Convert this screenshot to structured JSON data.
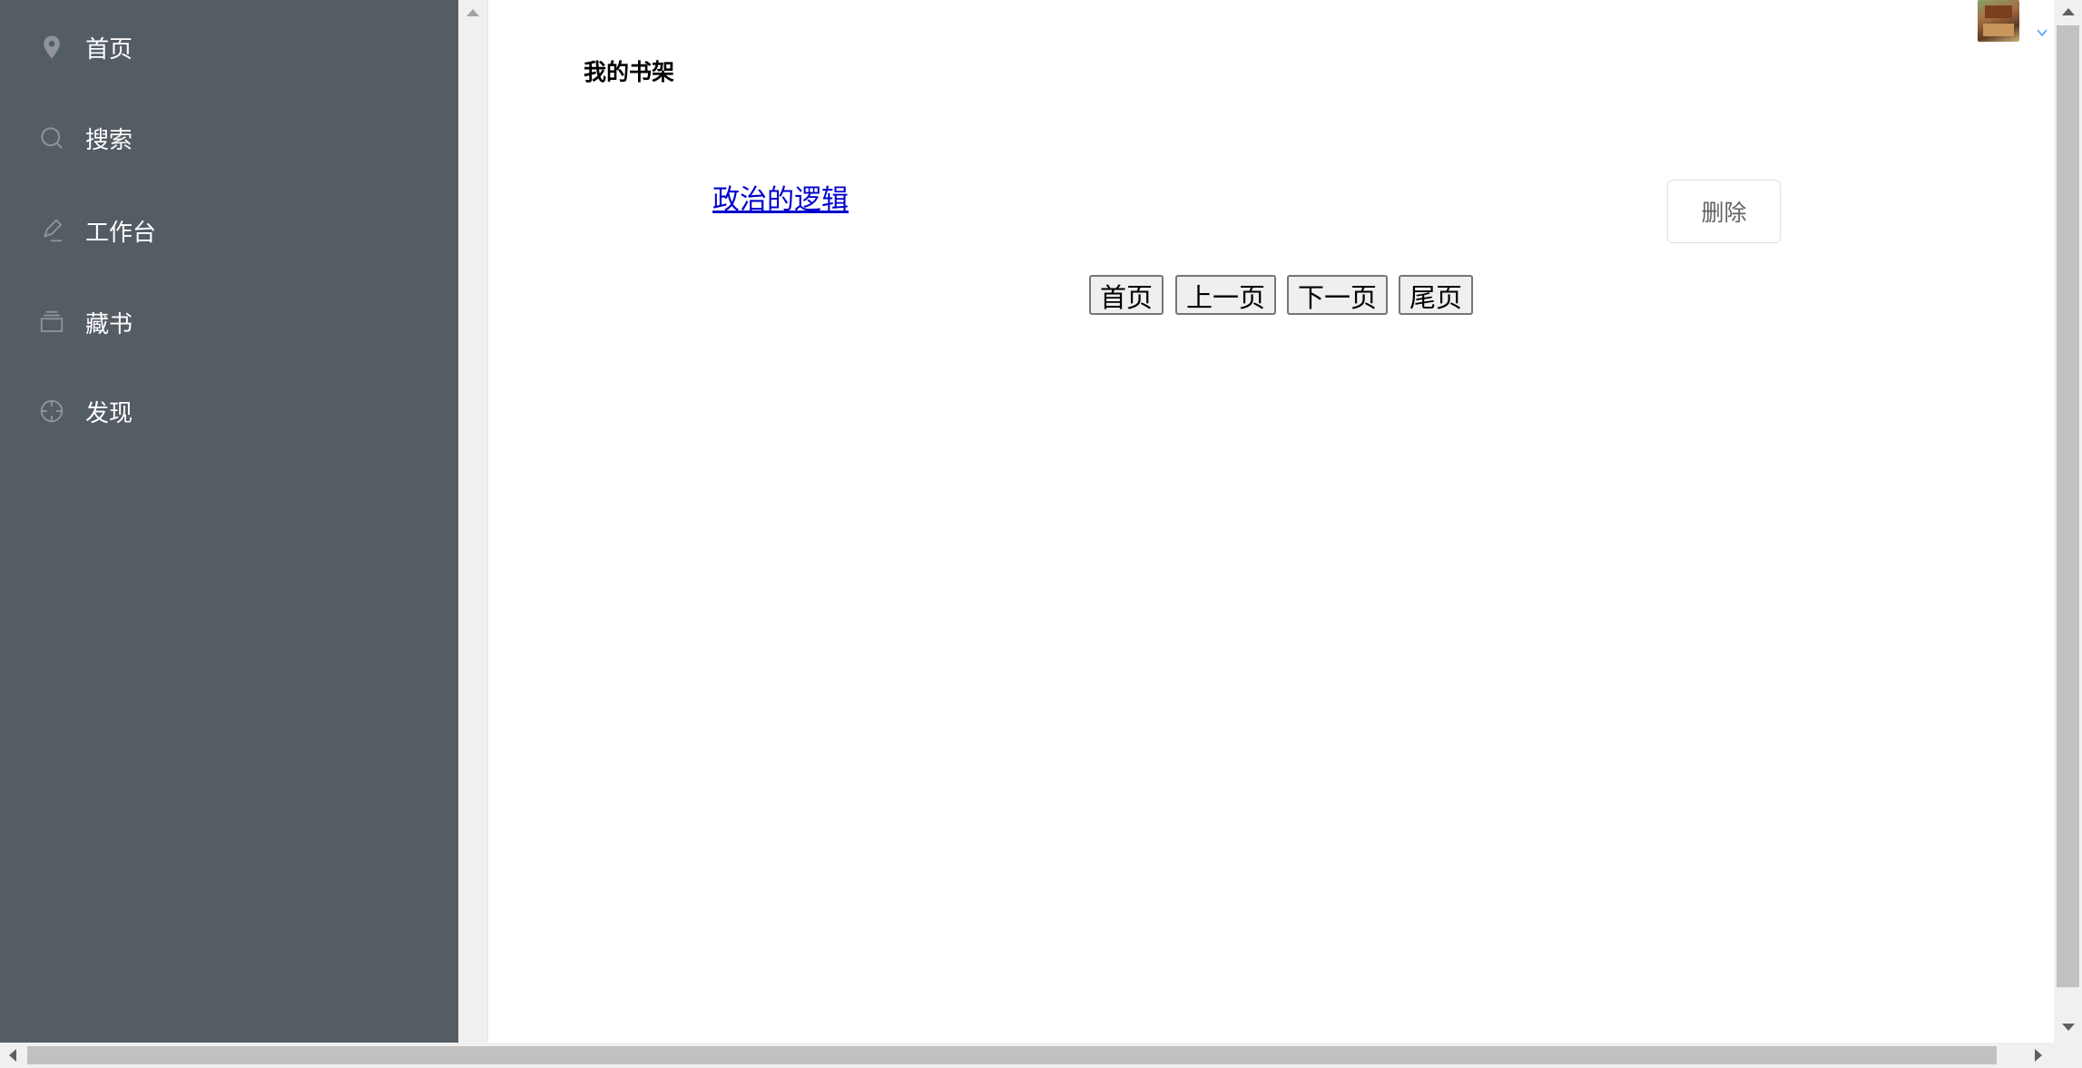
{
  "sidebar": {
    "background": "#545c64",
    "items": [
      {
        "label": "首页",
        "icon": "location-icon"
      },
      {
        "label": "搜索",
        "icon": "search-icon"
      },
      {
        "label": "工作台",
        "icon": "edit-icon"
      },
      {
        "label": "藏书",
        "icon": "collection-icon"
      },
      {
        "label": "发现",
        "icon": "discover-icon"
      }
    ]
  },
  "main": {
    "title": "我的书架",
    "books": [
      {
        "title": "政治的逻辑",
        "delete_label": "删除"
      }
    ],
    "pager": {
      "first": "首页",
      "prev": "上一页",
      "next": "下一页",
      "last": "尾页"
    }
  },
  "header": {
    "avatar": "avatar",
    "dropdown_icon": "chevron-down-icon"
  },
  "colors": {
    "link": "#0000cc",
    "sidebar_text": "#ffffff"
  }
}
